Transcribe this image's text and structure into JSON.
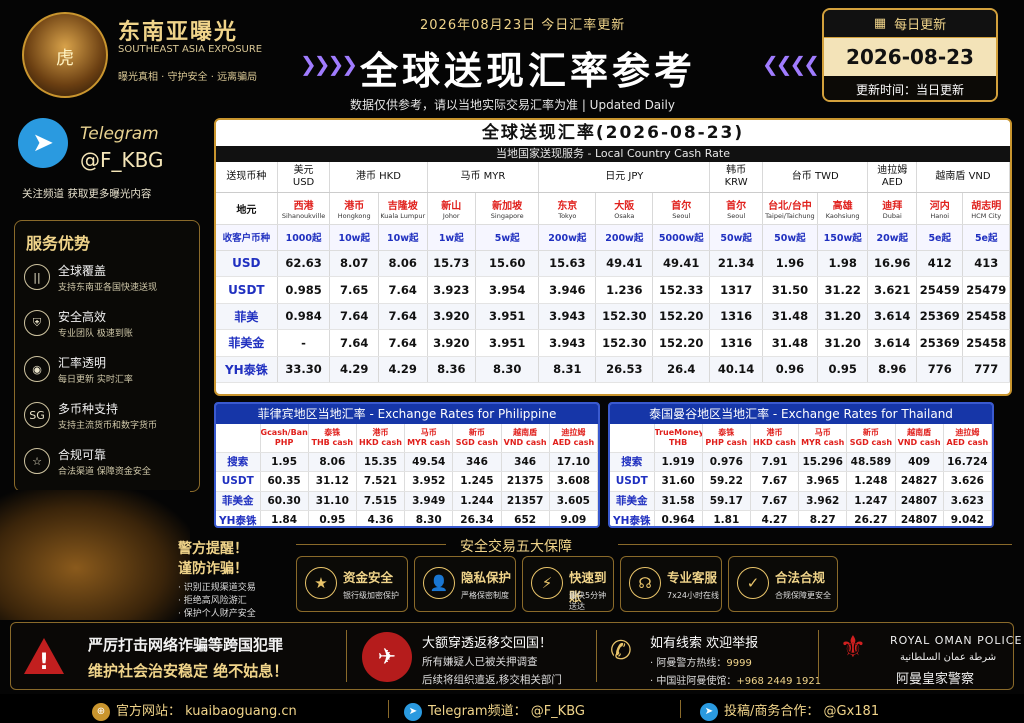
{
  "brand": {
    "name_cn": "东南亚曝光",
    "name_en": "SOUTHEAST ASIA EXPOSURE",
    "slogan": "曝光真相 · 守护安全 · 远离骗局",
    "logo_char": "虎"
  },
  "header": {
    "top_date": "2026年08月23日 今日汇率更新",
    "title": "全球送现汇率参考",
    "disclaimer": "数据仅供参考，请以当地实际交易汇率为准 | Updated Daily"
  },
  "date_box": {
    "label": "每日更新",
    "date": "2026-08-23",
    "update": "更新时间：当日更新"
  },
  "telegram": {
    "name": "Telegram",
    "handle": "@F_KBG",
    "sub": "关注频道  获取更多曝光内容"
  },
  "advantages": {
    "title": "服务优势",
    "items": [
      {
        "icon": "bars-icon",
        "glyph": "||",
        "title": "全球覆盖",
        "desc": "支持东南亚各国快速送现"
      },
      {
        "icon": "shield-icon",
        "glyph": "⛨",
        "title": "安全高效",
        "desc": "专业团队 极速到账"
      },
      {
        "icon": "eye-icon",
        "glyph": "◉",
        "title": "汇率透明",
        "desc": "每日更新 实时汇率"
      },
      {
        "icon": "sg-icon",
        "glyph": "SG",
        "title": "多币种支持",
        "desc": "支持主流货币和数字货币"
      },
      {
        "icon": "star-icon",
        "glyph": "☆",
        "title": "合规可靠",
        "desc": "合法渠道 保障资金安全"
      }
    ]
  },
  "warning": {
    "line1": "警方提醒！",
    "line2": "谨防诈骗！",
    "items": [
      "· 识别正规渠道交易",
      "· 拒绝高风险游汇",
      "· 保护个人财产安全"
    ]
  },
  "main_table": {
    "title": "全球送现汇率(2026-08-23)",
    "subtitle": "当地国家送现服务 - Local Country Cash Rate",
    "head": [
      "送现币种",
      "美元\nUSD",
      "港币  HKD",
      "马币  MYR",
      "日元  JPY",
      "韩币\nKRW",
      "台币  TWD",
      "迪拉姆\nAED",
      "越南盾  VND"
    ],
    "cities": [
      {
        "cn": "地元",
        "en": ""
      },
      {
        "cn": "西港",
        "en": "Sihanoukville"
      },
      {
        "cn": "港币",
        "en": "Hongkong"
      },
      {
        "cn": "吉隆坡",
        "en": "Kuala Lumpur"
      },
      {
        "cn": "新山",
        "en": "Johor"
      },
      {
        "cn": "新加坡",
        "en": "Singapore"
      },
      {
        "cn": "东京",
        "en": "Tokyo"
      },
      {
        "cn": "大阪",
        "en": "Osaka"
      },
      {
        "cn": "首尔",
        "en": "Seoul"
      },
      {
        "cn": "首尔",
        "en": "Seoul"
      },
      {
        "cn": "台北/台中",
        "en": "Taipei/Taichung"
      },
      {
        "cn": "高雄",
        "en": "Kaohsiung"
      },
      {
        "cn": "迪拜",
        "en": "Dubai"
      },
      {
        "cn": "河内",
        "en": "Hanoi"
      },
      {
        "cn": "胡志明",
        "en": "HCM City"
      }
    ],
    "minimums": [
      "收客户币种",
      "1000起",
      "10w起",
      "10w起",
      "1w起",
      "5w起",
      "200w起",
      "200w起",
      "5000w起",
      "50w起",
      "50w起",
      "150w起",
      "20w起",
      "5e起",
      "5e起"
    ],
    "rows": [
      [
        "USD",
        "62.63",
        "8.07",
        "8.06",
        "15.73",
        "15.60",
        "15.63",
        "49.41",
        "49.41",
        "21.34",
        "1.96",
        "1.98",
        "16.96",
        "412",
        "413"
      ],
      [
        "USDT",
        "0.985",
        "7.65",
        "7.64",
        "3.923",
        "3.954",
        "3.946",
        "1.236",
        "152.33",
        "1317",
        "31.50",
        "31.22",
        "3.621",
        "25459",
        "25479"
      ],
      [
        "菲美",
        "0.984",
        "7.64",
        "7.64",
        "3.920",
        "3.951",
        "3.943",
        "152.30",
        "152.20",
        "1316",
        "31.48",
        "31.20",
        "3.614",
        "25369",
        "25458"
      ],
      [
        "菲美金",
        "-",
        "7.64",
        "7.64",
        "3.920",
        "3.951",
        "3.943",
        "152.30",
        "152.20",
        "1316",
        "31.48",
        "31.20",
        "3.614",
        "25369",
        "25458"
      ],
      [
        "YH泰铢",
        "33.30",
        "4.29",
        "4.29",
        "8.36",
        "8.30",
        "8.31",
        "26.53",
        "26.4",
        "40.14",
        "0.96",
        "0.95",
        "8.96",
        "776",
        "777"
      ]
    ]
  },
  "ph_table": {
    "title": "菲律宾地区当地汇率 - Exchange Rates for Philippine",
    "head": [
      "",
      "Gcash/Bank\nPHP",
      "泰铢\nTHB cash",
      "港币\nHKD cash",
      "马币\nMYR cash",
      "新币\nSGD cash",
      "越南盾\nVND cash",
      "迪拉姆\nAED cash"
    ],
    "rows": [
      [
        "搜索",
        "1.95",
        "8.06",
        "15.35",
        "49.54",
        "346",
        "346",
        "17.10"
      ],
      [
        "USDT",
        "60.35",
        "31.12",
        "7.521",
        "3.952",
        "1.245",
        "21375",
        "3.608"
      ],
      [
        "菲美金",
        "60.30",
        "31.10",
        "7.515",
        "3.949",
        "1.244",
        "21357",
        "3.605"
      ],
      [
        "YH泰铢",
        "1.84",
        "0.95",
        "4.36",
        "8.30",
        "26.34",
        "652",
        "9.09"
      ]
    ]
  },
  "th_table": {
    "title": "泰国曼谷地区当地汇率 - Exchange Rates for Thailand",
    "head": [
      "",
      "TrueMoney\nTHB",
      "泰铢\nPHP cash",
      "港币\nHKD cash",
      "马币\nMYR cash",
      "新币\nSGD cash",
      "越南盾\nVND cash",
      "迪拉姆\nAED cash"
    ],
    "rows": [
      [
        "搜索",
        "1.919",
        "0.976",
        "7.91",
        "15.296",
        "48.589",
        "409",
        "16.724"
      ],
      [
        "USDT",
        "31.60",
        "59.22",
        "7.67",
        "3.965",
        "1.248",
        "24827",
        "3.626"
      ],
      [
        "菲美金",
        "31.58",
        "59.17",
        "7.67",
        "3.962",
        "1.247",
        "24807",
        "3.623"
      ],
      [
        "YH泰铢",
        "0.964",
        "1.81",
        "4.27",
        "8.27",
        "26.27",
        "24807",
        "9.042"
      ]
    ]
  },
  "guarantees": {
    "title": "安全交易五大保障",
    "items": [
      {
        "icon": "shield-star-icon",
        "glyph": "★",
        "title": "资金安全",
        "desc": "银行级加密保护"
      },
      {
        "icon": "user-lock-icon",
        "glyph": "👤",
        "title": "隐私保护",
        "desc": "严格保密制度"
      },
      {
        "icon": "lightning-icon",
        "glyph": "⚡",
        "title": "快速到账",
        "desc": "最快5分钟送达"
      },
      {
        "icon": "headset-icon",
        "glyph": "☊",
        "title": "专业客服",
        "desc": "7x24小时在线"
      },
      {
        "icon": "check-icon",
        "glyph": "✓",
        "title": "合法合规",
        "desc": "合规保障更安全"
      }
    ]
  },
  "bottom": {
    "crime1": "严厉打击网络诈骗等跨国犯罪",
    "crime2": "维护社会治安稳定  绝不姑息！",
    "return1": "大额穿透返移交回国！",
    "return2": "所有嫌疑人已被关押调查",
    "return3": "后续将组织遣返,移交相关部门",
    "clue1": "如有线索  欢迎举报",
    "clue2_label": "· 阿曼警方热线：",
    "clue2_val": "9999",
    "clue3_label": "· 中国驻阿曼使馆：",
    "clue3_val": "+968 2449 1921",
    "police_en": "ROYAL OMAN POLICE",
    "police_ar": "شرطة عمان السلطانية",
    "police_cn": "阿曼皇家警察"
  },
  "footer": {
    "site": "官方网站：  kuaibaoguang.cn",
    "tg": "Telegram频道：  @F_KBG",
    "contact": "投稿/商务合作：  @Gx181"
  }
}
